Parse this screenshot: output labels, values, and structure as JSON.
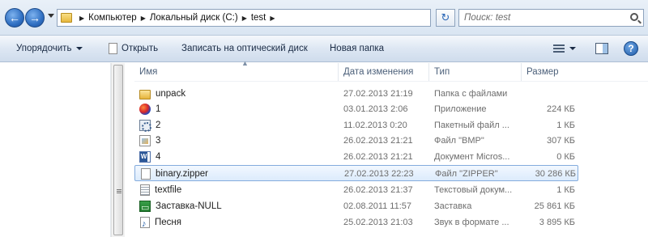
{
  "address": {
    "breadcrumbs": [
      "Компьютер",
      "Локальный диск (C:)",
      "test"
    ],
    "search_placeholder": "Поиск: test"
  },
  "toolbar": {
    "organize_label": "Упорядочить",
    "open_label": "Открыть",
    "burn_label": "Записать на оптический диск",
    "newfolder_label": "Новая папка"
  },
  "columns": {
    "name": "Имя",
    "date": "Дата изменения",
    "type": "Тип",
    "size": "Размер"
  },
  "files": [
    {
      "name": "unpack",
      "date": "27.02.2013 21:19",
      "type": "Папка с файлами",
      "size": "",
      "icon": "folder-icon"
    },
    {
      "name": "1",
      "date": "03.01.2013 2:06",
      "type": "Приложение",
      "size": "224 КБ",
      "icon": "application-icon"
    },
    {
      "name": "2",
      "date": "11.02.2013 0:20",
      "type": "Пакетный файл ...",
      "size": "1 КБ",
      "icon": "batch-file-icon"
    },
    {
      "name": "3",
      "date": "26.02.2013 21:21",
      "type": "Файл \"BMP\"",
      "size": "307 КБ",
      "icon": "bmp-file-icon"
    },
    {
      "name": "4",
      "date": "26.02.2013 21:21",
      "type": "Документ Micros...",
      "size": "0 КБ",
      "icon": "word-document-icon"
    },
    {
      "name": "binary.zipper",
      "date": "27.02.2013 22:23",
      "type": "Файл \"ZIPPER\"",
      "size": "30 286 КБ",
      "icon": "generic-file-icon",
      "selected": true
    },
    {
      "name": "textfile",
      "date": "26.02.2013 21:37",
      "type": "Текстовый докум...",
      "size": "1 КБ",
      "icon": "text-file-icon"
    },
    {
      "name": "Заставка-NULL",
      "date": "02.08.2011 11:57",
      "type": "Заставка",
      "size": "25 861 КБ",
      "icon": "screensaver-icon"
    },
    {
      "name": "Песня",
      "date": "25.02.2013 21:03",
      "type": "Звук в формате ...",
      "size": "3 895 КБ",
      "icon": "audio-file-icon"
    }
  ]
}
